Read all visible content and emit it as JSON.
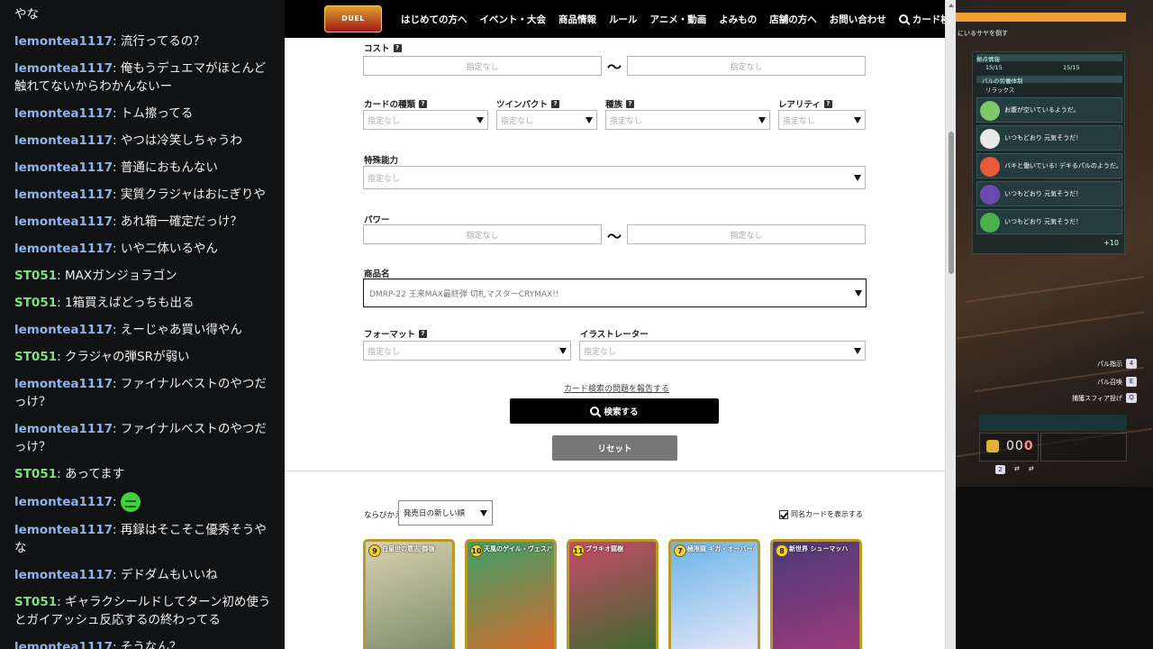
{
  "chat": {
    "messages": [
      {
        "user": "",
        "text": "やな"
      },
      {
        "user": "lemontea1117",
        "text": "流行ってるの？"
      },
      {
        "user": "lemontea1117",
        "text": "俺もうデュエマがほとんど触れてないからわかんないー"
      },
      {
        "user": "lemontea1117",
        "text": "トム擦ってる"
      },
      {
        "user": "lemontea1117",
        "text": "やつは冷笑しちゃうわ"
      },
      {
        "user": "lemontea1117",
        "text": "普通におもんない"
      },
      {
        "user": "lemontea1117",
        "text": "実質クラジャはおにぎりや"
      },
      {
        "user": "lemontea1117",
        "text": "あれ箱一確定だっけ？"
      },
      {
        "user": "lemontea1117",
        "text": "いや二体いるやん"
      },
      {
        "user": "ST051",
        "text": "MAXガンジョラゴン"
      },
      {
        "user": "ST051",
        "text": "1箱買えばどっちも出る"
      },
      {
        "user": "lemontea1117",
        "text": "えーじゃあ買い得やん"
      },
      {
        "user": "ST051",
        "text": "クラジャの弾SRが弱い"
      },
      {
        "user": "lemontea1117",
        "text": "ファイナルベストのやつだっけ？"
      },
      {
        "user": "lemontea1117",
        "text": "ファイナルベストのやつだっけ？"
      },
      {
        "user": "ST051",
        "text": "あってます"
      },
      {
        "user": "lemontea1117",
        "text": "",
        "emote": "green-face-emote"
      },
      {
        "user": "lemontea1117",
        "text": "再録はそこそこ優秀そうやな"
      },
      {
        "user": "lemontea1117",
        "text": "デドダムもいいね"
      },
      {
        "user": "ST051",
        "text": "ギャラクシールドしてターン初め使うとガイアッシュ反応するの終わってる"
      },
      {
        "user": "lemontea1117",
        "text": "そうなん？"
      }
    ],
    "colors": {
      "lemontea1117": "#8fb4e8",
      "ST051": "#7ee07e"
    }
  },
  "site": {
    "logo_text": "DUEL MASTERS",
    "nav": [
      "はじめての方へ",
      "イベント・大会",
      "商品情報",
      "ルール",
      "アニメ・動画",
      "よみもの",
      "店舗の方へ",
      "お問い合わせ",
      "カード検索"
    ],
    "help_glyph": "?",
    "tilde": "〜",
    "form": {
      "cost_label": "コスト",
      "cost_min_placeholder": "指定なし",
      "cost_max_placeholder": "指定なし",
      "card_type_label": "カードの種類",
      "card_type_value": "指定なし",
      "twinpact_label": "ツインパクト",
      "twinpact_value": "指定なし",
      "race_label": "種族",
      "race_value": "指定なし",
      "rarity_label": "レアリティ",
      "rarity_value": "指定なし",
      "ability_label": "特殊能力",
      "ability_value": "指定なし",
      "power_label": "パワー",
      "power_min_placeholder": "指定なし",
      "power_max_placeholder": "指定なし",
      "product_label": "商品名",
      "product_value": "DMRP-22 王来MAX最終弾 切札マスターCRYMAX!!",
      "format_label": "フォーマット",
      "format_value": "指定なし",
      "illustrator_label": "イラストレーター",
      "illustrator_value": "指定なし",
      "report_link": "カード検索の問題を報告する",
      "search_button": "検索する",
      "reset_button": "リセット"
    },
    "results": {
      "sort_label": "ならびかえ",
      "sort_value": "発売日の新しい順",
      "same_name_label": "同名カードを表示する",
      "same_name_checked": true,
      "cards": [
        {
          "cost": "9",
          "name": "白皇世の意志 御嶺",
          "colors": [
            "#d8d2b0",
            "#7a8a6a"
          ]
        },
        {
          "cost": "10",
          "name": "天風のゲイル・ヴェスパー",
          "colors": [
            "#3aa06a",
            "#d86a2a"
          ]
        },
        {
          "cost": "11",
          "name": "ブラキオ龍樹",
          "colors": [
            "#c84a6a",
            "#3a6a2a"
          ]
        },
        {
          "cost": "7",
          "name": "極限龍 ギガ・オーバーヘヴン",
          "colors": [
            "#6ab4e8",
            "#e8e8f8"
          ]
        },
        {
          "cost": "8",
          "name": "新世界 シューマッハ",
          "colors": [
            "#4a3a7a",
            "#a03a7a"
          ]
        }
      ]
    }
  },
  "game": {
    "quest_text": "にいるサヤを倒す",
    "base_title": "拠点情報",
    "base_counts": [
      "15/15",
      "15/15"
    ],
    "work_title": "パルの労働体制",
    "work_status": "リラックス",
    "pals": [
      {
        "text": "お腹が空いているようだ。",
        "color": "#7ec86a"
      },
      {
        "text": "いつもどおり 元気そうだ！",
        "color": "#e8e8e8"
      },
      {
        "text": "バキと働いている! デキるパルのようだ。",
        "color": "#e85a3a"
      },
      {
        "text": "いつもどおり 元気そうだ！",
        "color": "#6a4ab0"
      },
      {
        "text": "いつもどおり 元気そうだ！",
        "color": "#4ab04a"
      }
    ],
    "more_count": "+10",
    "hints": [
      {
        "label": "パル指示",
        "key": "4"
      },
      {
        "label": "パル召喚",
        "key": "E"
      },
      {
        "label": "捕獲スフィア投げ",
        "key": "Q"
      }
    ],
    "ammo": "000",
    "hud_keys": [
      "2",
      "⇄",
      "⇄"
    ]
  }
}
